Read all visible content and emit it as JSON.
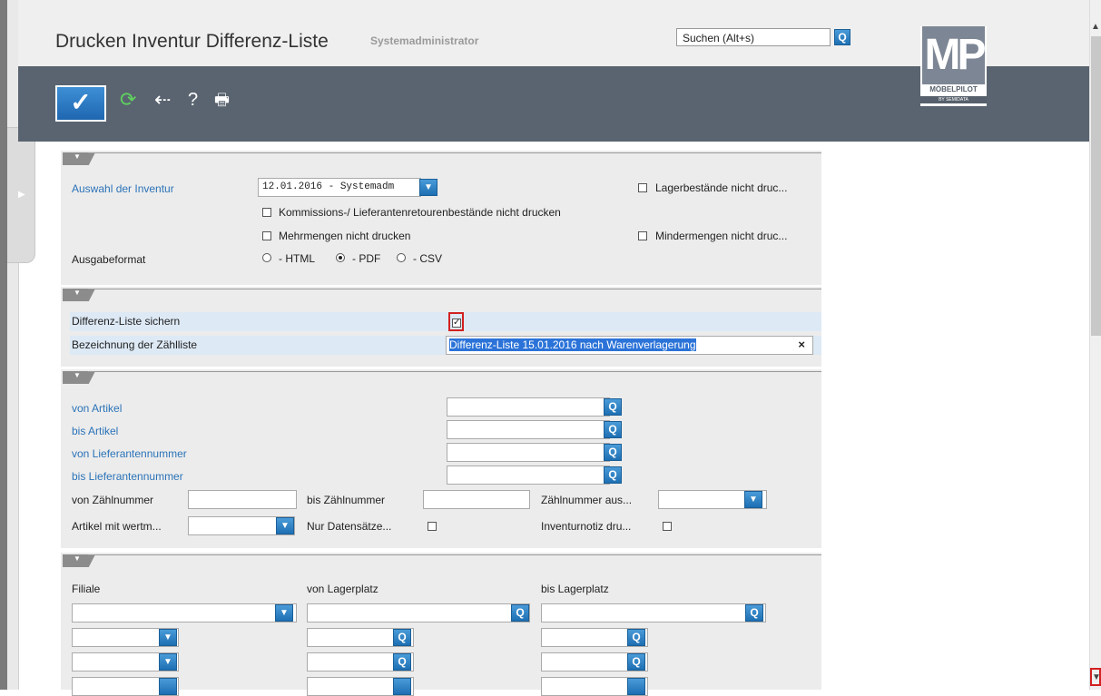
{
  "header": {
    "title": "Drucken Inventur Differenz-Liste",
    "user": "Systemadministrator",
    "search_placeholder": "Suchen (Alt+s)",
    "logo_text": "MP",
    "logo_brand": "MÖBELPILOT",
    "logo_sub": "BY SEMIDATA"
  },
  "toolbar": {
    "ok_icon": "checkmark-icon",
    "refresh_icon": "refresh-icon",
    "back_icon": "back-arrow-icon",
    "help_label": "?",
    "print_icon": "printer-icon"
  },
  "section1": {
    "inventur_label": "Auswahl der Inventur",
    "inventur_value": "12.01.2016 - Systemadm",
    "lager_label": "Lagerbestände nicht druc...",
    "kommission_label": "Kommissions-/ Lieferantenretourenbestände nicht drucken",
    "mehrmengen_label": "Mehrmengen nicht drucken",
    "mindermengen_label": "Mindermengen nicht druc...",
    "ausgabe_label": "Ausgabeformat",
    "format_html": "- HTML",
    "format_pdf": "- PDF",
    "format_csv": "- CSV",
    "selected_format": "PDF"
  },
  "section2": {
    "sichern_label": "Differenz-Liste sichern",
    "sichern_checked": true,
    "bezeichnung_label": "Bezeichnung der Zählliste",
    "bezeichnung_value": "Differenz-Liste 15.01.2016 nach Warenverlagerung",
    "clear_label": "×"
  },
  "section3": {
    "von_artikel": "von Artikel",
    "bis_artikel": "bis Artikel",
    "von_lieferant": "von Lieferantennummer",
    "bis_lieferant": "bis Lieferantennummer",
    "von_zaehl": "von Zählnummer",
    "bis_zaehl": "bis Zählnummer",
    "zaehl_aus": "Zählnummer aus...",
    "artikel_wert": "Artikel mit wertm...",
    "nur_daten": "Nur Datensätze...",
    "inventurnotiz": "Inventurnotiz dru..."
  },
  "section4": {
    "filiale": "Filiale",
    "von_lager": "von Lagerplatz",
    "bis_lager": "bis Lagerplatz"
  }
}
